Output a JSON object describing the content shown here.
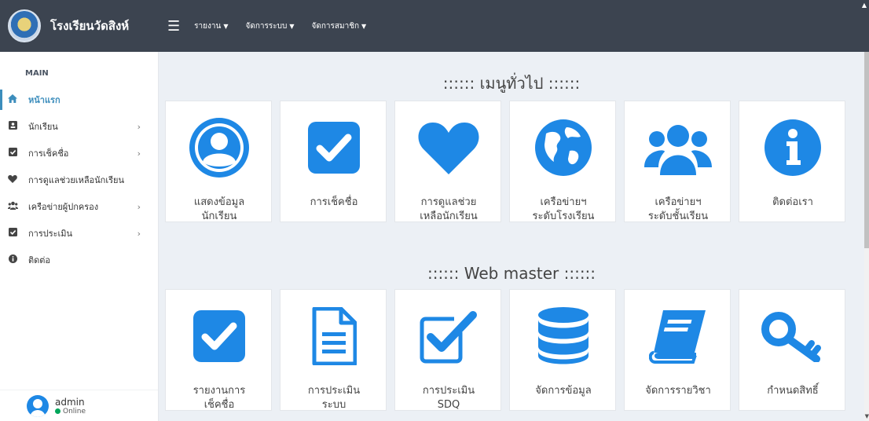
{
  "app": {
    "brand_name": "โรงเรียนวัดสิงห์"
  },
  "navbar": {
    "menus": [
      {
        "label": "รายงาน"
      },
      {
        "label": "จัดการระบบ"
      },
      {
        "label": "จัดการสมาชิก"
      }
    ]
  },
  "sidebar": {
    "header": "MAIN",
    "items": [
      {
        "label": "หน้าแรก",
        "icon": "home-icon",
        "active": true,
        "has_children": false
      },
      {
        "label": "นักเรียน",
        "icon": "id-card-icon",
        "has_children": true
      },
      {
        "label": "การเช็คชื่อ",
        "icon": "check-square-icon",
        "has_children": true
      },
      {
        "label": "การดูแลช่วยเหลือนักเรียน",
        "icon": "heart-icon",
        "has_children": false
      },
      {
        "label": "เครือข่ายผู้ปกครอง",
        "icon": "users-icon",
        "has_children": true
      },
      {
        "label": "การประเมิน",
        "icon": "check-square-icon",
        "has_children": true
      },
      {
        "label": "ติดต่อ",
        "icon": "info-circle-icon",
        "has_children": false
      }
    ],
    "user": {
      "name": "admin",
      "status": "Online"
    }
  },
  "main": {
    "section1": {
      "title": ":::::: เมนูทั่วไป ::::::",
      "tiles": [
        {
          "label": "แสดงข้อมูลนักเรียน",
          "line1": "แสดงข้อมูล",
          "line2": "นักเรียน",
          "icon": "user-circle-icon"
        },
        {
          "label": "การเช็คชื่อ",
          "line1": "การเช็คชื่อ",
          "line2": "",
          "icon": "check-square-icon"
        },
        {
          "label": "การดูแลช่วยเหลือนักเรียน",
          "line1": "การดูแลช่วย",
          "line2": "เหลือนักเรียน",
          "icon": "heart-icon"
        },
        {
          "label": "เครือข่ายฯ ระดับโรงเรียน",
          "line1": "เครือข่ายฯ",
          "line2": "ระดับโรงเรียน",
          "icon": "globe-icon"
        },
        {
          "label": "เครือข่ายฯ ระดับชั้นเรียน",
          "line1": "เครือข่ายฯ",
          "line2": "ระดับชั้นเรียน",
          "icon": "users-icon"
        },
        {
          "label": "ติดต่อเรา",
          "line1": "ติดต่อเรา",
          "line2": "",
          "icon": "info-circle-icon"
        }
      ]
    },
    "section2": {
      "title": ":::::: Web master ::::::",
      "tiles": [
        {
          "label": "รายงานการเช็คชื่อ",
          "line1": "รายงานการ",
          "line2": "เช็คชื่อ",
          "icon": "check-square-icon"
        },
        {
          "label": "การประเมินระบบ",
          "line1": "การประเมิน",
          "line2": "ระบบ",
          "icon": "file-text-icon"
        },
        {
          "label": "การประเมิน SDQ",
          "line1": "การประเมิน",
          "line2": "SDQ",
          "icon": "check-square-outline-icon"
        },
        {
          "label": "จัดการข้อมูล",
          "line1": "จัดการข้อมูล",
          "line2": "",
          "icon": "database-icon"
        },
        {
          "label": "จัดการรายวิชา",
          "line1": "จัดการรายวิชา",
          "line2": "",
          "icon": "book-icon"
        },
        {
          "label": "กำหนดสิทธิ์",
          "line1": "กำหนดสิทธิ์",
          "line2": "",
          "icon": "key-icon"
        }
      ]
    }
  },
  "colors": {
    "accent": "#1e88e5",
    "navbar": "#3c4450",
    "sidebar_active": "#3c8dbc",
    "online": "#00a65a"
  }
}
